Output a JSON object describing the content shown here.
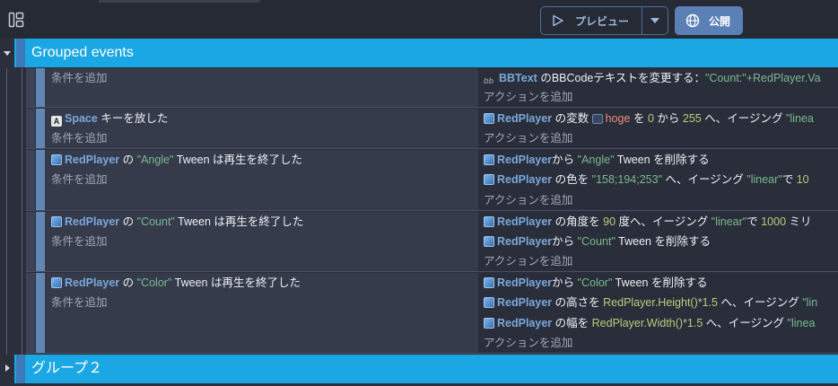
{
  "toolbar": {
    "layout_icon": "layout-panels-icon",
    "preview_label": "プレビュー",
    "preview_icon": "play-icon",
    "dropdown_icon": "chevron-down-icon",
    "publish_label": "公開",
    "publish_icon": "globe-icon"
  },
  "colors": {
    "group_header": "#1ba6e4",
    "event_bar": "#6287b4",
    "object_name": "#7aa8dc",
    "string_value": "#79b98e",
    "number_value": "#b3cf7c",
    "variable_name": "#f08a7a"
  },
  "groups": [
    {
      "title": "Grouped events",
      "expanded": true
    },
    {
      "title": "グループ２",
      "expanded": false
    }
  ],
  "events": [
    {
      "conditions": [],
      "add_condition": "条件を追加",
      "actions": [
        {
          "icon": "bbtext-icon",
          "object": "BBText",
          "text": "のBBCodeテキストを変更する：",
          "value": "\"Count:\"+RedPlayer.Va"
        }
      ],
      "add_action": "アクションを追加"
    },
    {
      "conditions": [
        {
          "icon": "keyboard-icon",
          "key": "Space",
          "text": "キーを放した"
        }
      ],
      "add_condition": "条件を追加",
      "actions": [
        {
          "icon": "sprite-icon",
          "object": "RedPlayer",
          "p1": "の変数",
          "var_icon": "variable-icon",
          "var": "hoge",
          "p2": "を",
          "n1": "0",
          "p3": "から",
          "n2": "255",
          "p4": "へ、イージング",
          "s1": "\"linea"
        }
      ],
      "add_action": "アクションを追加"
    },
    {
      "conditions": [
        {
          "icon": "sprite-icon",
          "object": "RedPlayer",
          "p1": "の",
          "name": "\"Angle\"",
          "p2": "Tween は再生を終了した"
        }
      ],
      "add_condition": "条件を追加",
      "actions": [
        {
          "icon": "sprite-icon",
          "object": "RedPlayer",
          "p1": "から",
          "s1": "\"Angle\"",
          "p2": "Tween を削除する"
        },
        {
          "icon": "sprite-icon",
          "object": "RedPlayer",
          "p1": "の色を",
          "s1": "\"158;194;253\"",
          "p2": "へ、イージング",
          "s2": "\"linear\"",
          "p3": "で",
          "n1": "10"
        }
      ],
      "add_action": "アクションを追加"
    },
    {
      "conditions": [
        {
          "icon": "sprite-icon",
          "object": "RedPlayer",
          "p1": "の",
          "name": "\"Count\"",
          "p2": "Tween は再生を終了した"
        }
      ],
      "add_condition": "条件を追加",
      "actions": [
        {
          "icon": "sprite-icon",
          "object": "RedPlayer",
          "p1": "の角度を",
          "n1": "90",
          "p2": "度へ、イージング",
          "s1": "\"linear\"",
          "p3": "で",
          "n2": "1000",
          "p4": "ミリ"
        },
        {
          "icon": "sprite-icon",
          "object": "RedPlayer",
          "p1": "から",
          "s1": "\"Count\"",
          "p2": "Tween を削除する"
        }
      ],
      "add_action": "アクションを追加"
    },
    {
      "conditions": [
        {
          "icon": "sprite-icon",
          "object": "RedPlayer",
          "p1": "の",
          "name": "\"Color\"",
          "p2": "Tween は再生を終了した"
        }
      ],
      "add_condition": "条件を追加",
      "actions": [
        {
          "icon": "sprite-icon",
          "object": "RedPlayer",
          "p1": "から",
          "s1": "\"Color\"",
          "p2": "Tween を削除する"
        },
        {
          "icon": "sprite-icon",
          "object": "RedPlayer",
          "p1": "の高さを",
          "e1": "RedPlayer.Height()*1.5",
          "p2": "へ、イージング",
          "s1": "\"lin"
        },
        {
          "icon": "sprite-icon",
          "object": "RedPlayer",
          "p1": "の幅を",
          "e1": "RedPlayer.Width()*1.5",
          "p2": "へ、イージング",
          "s1": "\"linea"
        }
      ],
      "add_action": "アクションを追加"
    }
  ]
}
